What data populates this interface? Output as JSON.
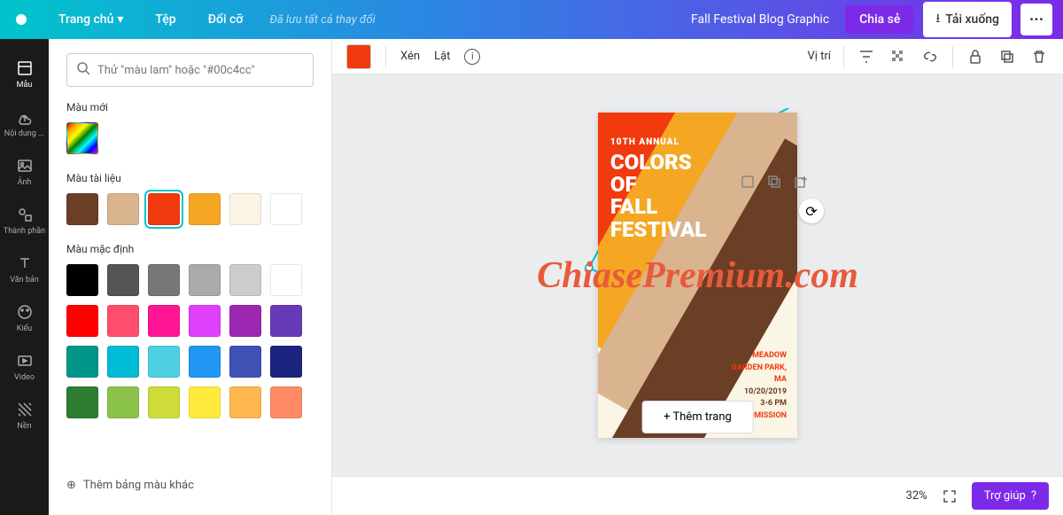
{
  "header": {
    "nav": {
      "home": "Trang chủ",
      "file": "Tệp",
      "resize": "Đổi cỡ"
    },
    "saved": "Đã lưu tất cả thay đổi",
    "doc_title": "Fall Festival Blog Graphic",
    "share": "Chia sẻ",
    "download": "Tải xuống",
    "more": "···"
  },
  "sidebar": {
    "items": [
      "Mẫu",
      "Nội dung ...",
      "Ảnh",
      "Thành phần",
      "Văn bản",
      "Kiểu",
      "Video",
      "Nền"
    ]
  },
  "panel": {
    "search_placeholder": "Thử \"màu lam\" hoặc \"#00c4cc\"",
    "new_color": "Màu mới",
    "doc_colors": "Màu tài liệu",
    "default_colors": "Màu mặc định",
    "add_more": "Thêm bảng màu khác",
    "doc_swatches": [
      "#6b3e26",
      "#d9b48f",
      "#f13a0e",
      "#f5a623",
      "#faf5e4",
      "#ffffff"
    ],
    "default_swatches": [
      "#000000",
      "#555555",
      "#777777",
      "#aaaaaa",
      "#cccccc",
      "#ffffff",
      "#ff0000",
      "#ff4d6d",
      "#ff1493",
      "#e040fb",
      "#9c27b0",
      "#673ab7",
      "#009688",
      "#00bcd4",
      "#4dd0e1",
      "#2196f3",
      "#3f51b5",
      "#1a237e",
      "#2e7d32",
      "#8bc34a",
      "#cddc39",
      "#ffeb3b",
      "#ffb74d",
      "#ff8a65"
    ]
  },
  "toolbar": {
    "crop": "Xén",
    "flip": "Lật",
    "position": "Vị trí"
  },
  "canvas": {
    "annual": "10TH ANNUAL",
    "title": "COLORS<br>OF<br>FALL<br>FESTIVAL",
    "venue1": "MEADOW",
    "venue2": "GARDEN PARK,",
    "venue3": "MA",
    "date": "10/20/2019",
    "time": "3-6 PM",
    "admission": "FREE ADMISSION",
    "watermark": "ChiasePremium.com",
    "add_page": "+ Thêm trang"
  },
  "bottom": {
    "zoom": "32%",
    "help": "Trợ giúp"
  }
}
